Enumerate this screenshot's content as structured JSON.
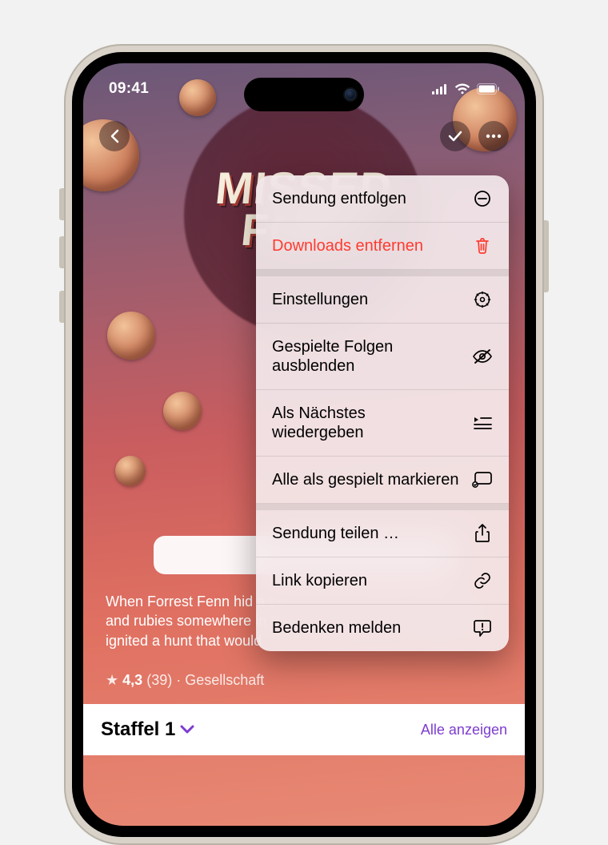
{
  "status": {
    "time": "09:41"
  },
  "artwork": {
    "line1": "MISSED",
    "line2": "FORT"
  },
  "description": "When Forrest Fenn hid a treasure chest of gold, sapphires, and rubies somewhere in the Rocky Mountains in 2010, he ignited a hunt that would",
  "rating": {
    "value": "4,3",
    "count": "(39)",
    "category": "Gesellschaft"
  },
  "section": {
    "title": "Staffel 1",
    "see_all": "Alle anzeigen"
  },
  "menu": {
    "unfollow": "Sendung entfolgen",
    "remove_downloads": "Downloads entfernen",
    "settings": "Einstellungen",
    "hide_played": "Gespielte Folgen ausblenden",
    "play_next": "Als Nächstes wiedergeben",
    "mark_all_played": "Alle als gespielt markieren",
    "share": "Sendung teilen …",
    "copy_link": "Link kopieren",
    "report": "Bedenken melden"
  }
}
